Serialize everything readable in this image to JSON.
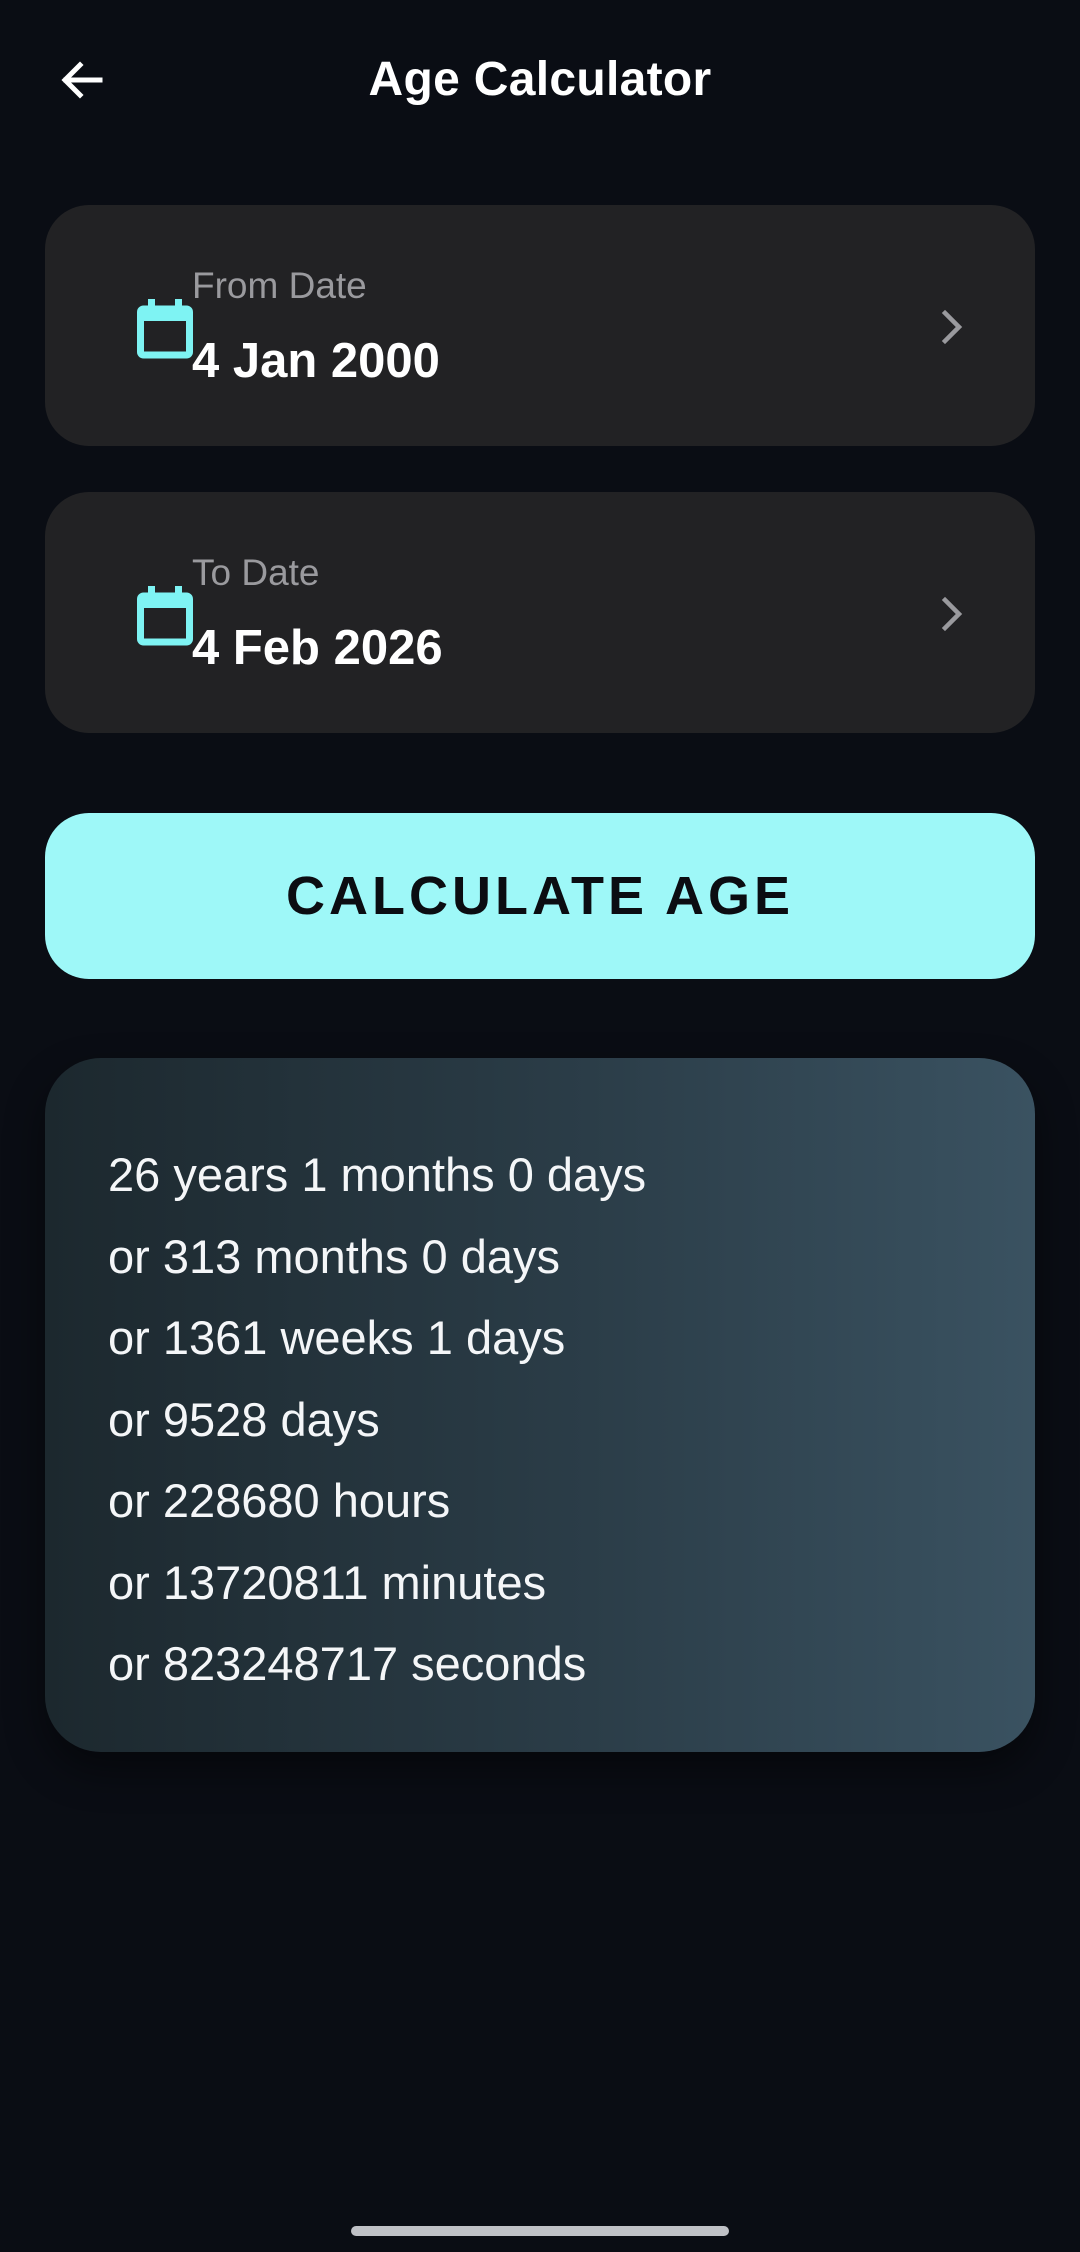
{
  "app_bar": {
    "title": "Age Calculator",
    "back_icon": "arrow-left-icon"
  },
  "from_date": {
    "label": "From Date",
    "value": "4 Jan 2000",
    "icon": "calendar-icon"
  },
  "to_date": {
    "label": "To Date",
    "value": "4 Feb 2026",
    "icon": "calendar-icon"
  },
  "calculate_button": {
    "label": "CALCULATE AGE"
  },
  "result": {
    "lines": [
      "26 years 1 months 0 days",
      "or 313 months 0 days",
      "or 1361 weeks 1 days",
      "or 9528 days",
      "or 228680 hours",
      "or 13720811 minutes",
      "or 823248717 seconds"
    ]
  },
  "colors": {
    "background": "#0a0d14",
    "card": "#222224",
    "accent": "#9ef8f8",
    "icon_accent": "#7ef3f3",
    "label_text": "#9a9a9e"
  }
}
